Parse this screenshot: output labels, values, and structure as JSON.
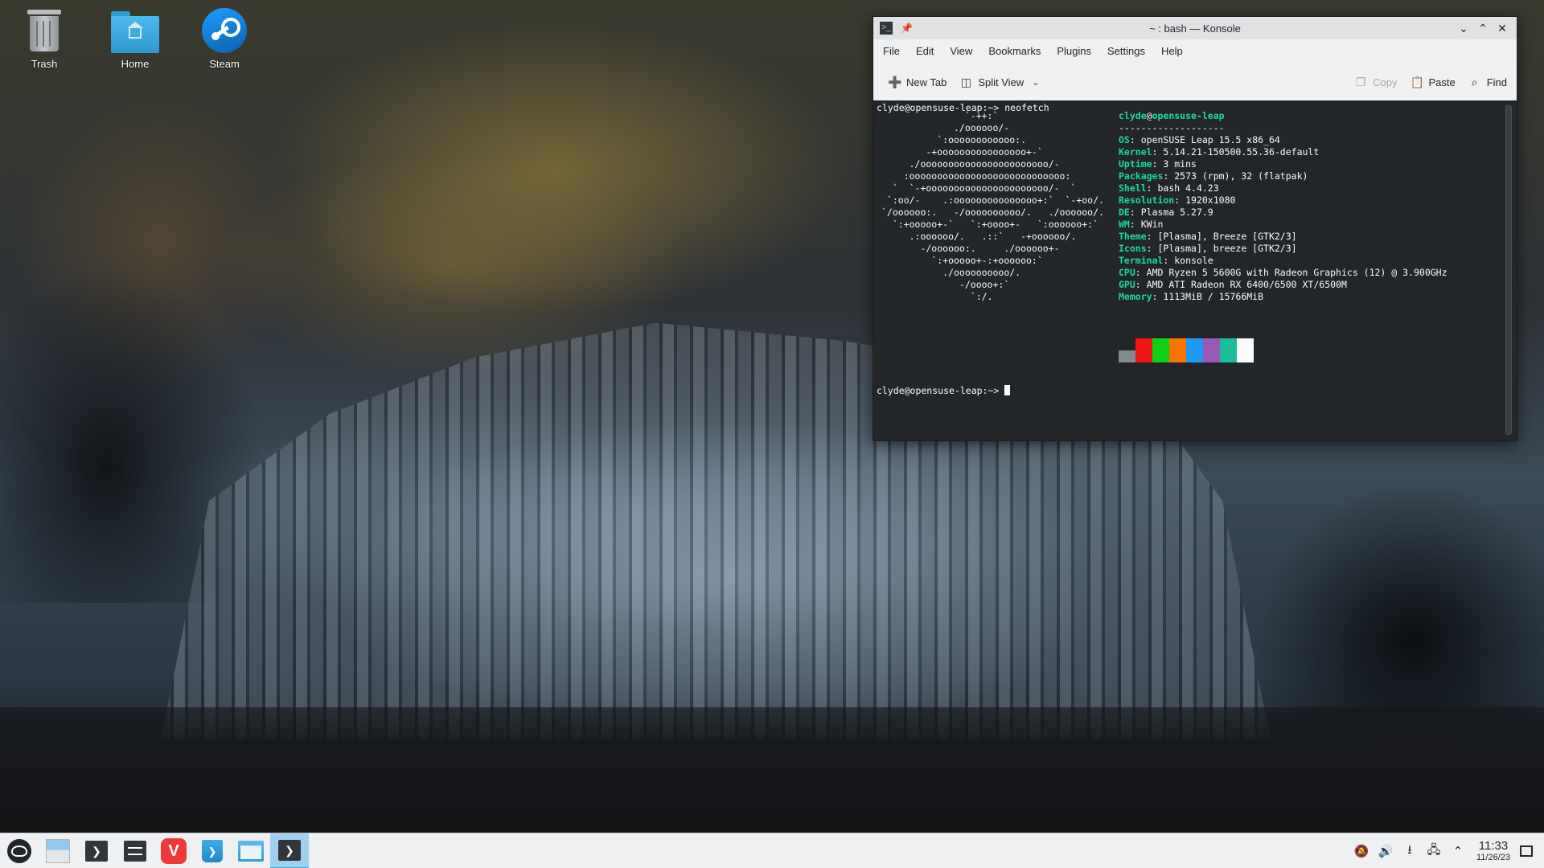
{
  "desktop": {
    "icons": [
      {
        "label": "Trash",
        "icon": "trash-icon"
      },
      {
        "label": "Home",
        "icon": "home-folder-icon"
      },
      {
        "label": "Steam",
        "icon": "steam-icon"
      }
    ]
  },
  "window": {
    "title": "~ : bash — Konsole",
    "app_icon": "konsole-icon",
    "controls": {
      "minimize": "minimize-icon",
      "maximize": "maximize-icon",
      "close": "close-icon"
    },
    "menu": [
      "File",
      "Edit",
      "View",
      "Bookmarks",
      "Plugins",
      "Settings",
      "Help"
    ],
    "toolbar": {
      "new_tab": "New Tab",
      "split_view": "Split View",
      "copy": "Copy",
      "paste": "Paste",
      "find": "Find"
    }
  },
  "terminal": {
    "prompt1": "clyde@opensuse-leap:~> neofetch",
    "logo_lines": [
      "               `-++:`",
      "             ./oooooo/-",
      "          `:oooooooooooo:.",
      "        -+oooooooooooooooo+-`",
      "     ./ooooooooooooooooooooooo/-",
      "    :oooooooooooooooooooooooooooo:",
      "  `  `-+oooooooooooooooooooooo/-  `",
      " `:oo/-    .:ooooooooooooooo+:`  `-+oo/.",
      "`/oooooo:.   -/oooooooooo/.   ./oooooo/.",
      "  `:+ooooo+-`   `:+oooo+-   `:oooooo+:`",
      "     .:oooooo/.   .::`   -+oooooo/.",
      "       -/oooooo:.     ./oooooo+-",
      "         `:+ooooo+-:+oooooo:`",
      "           ./oooooooooo/.",
      "              -/oooo+:`",
      "                `:/."
    ],
    "user": "clyde",
    "host": "opensuse-leap",
    "separator": "-------------------",
    "info": [
      {
        "key": "OS",
        "value": "openSUSE Leap 15.5 x86_64"
      },
      {
        "key": "Kernel",
        "value": "5.14.21-150500.55.36-default"
      },
      {
        "key": "Uptime",
        "value": "3 mins"
      },
      {
        "key": "Packages",
        "value": "2573 (rpm), 32 (flatpak)"
      },
      {
        "key": "Shell",
        "value": "bash 4.4.23"
      },
      {
        "key": "Resolution",
        "value": "1920x1080"
      },
      {
        "key": "DE",
        "value": "Plasma 5.27.9"
      },
      {
        "key": "WM",
        "value": "KWin"
      },
      {
        "key": "Theme",
        "value": "[Plasma], Breeze [GTK2/3]"
      },
      {
        "key": "Icons",
        "value": "[Plasma], breeze [GTK2/3]"
      },
      {
        "key": "Terminal",
        "value": "konsole"
      },
      {
        "key": "CPU",
        "value": "AMD Ryzen 5 5600G with Radeon Graphics (12) @ 3.900GHz"
      },
      {
        "key": "GPU",
        "value": "AMD ATI Radeon RX 6400/6500 XT/6500M"
      },
      {
        "key": "Memory",
        "value": "1113MiB / 15766MiB"
      }
    ],
    "palette": [
      "#7f8c8d",
      "#ed1515",
      "#11d116",
      "#f67400",
      "#1d99f3",
      "#9b59b6",
      "#1abc9c",
      "#fcfcfc"
    ],
    "prompt2": "clyde@opensuse-leap:~> "
  },
  "taskbar": {
    "items": [
      {
        "name": "app-launcher",
        "icon": "opensuse-icon"
      },
      {
        "name": "show-desktop-pager",
        "icon": "desktop-pager-icon"
      },
      {
        "name": "konsole-launcher",
        "icon": "terminal-icon"
      },
      {
        "name": "system-settings",
        "icon": "settings-icon"
      },
      {
        "name": "vivaldi",
        "icon": "vivaldi-icon",
        "glyph": "V"
      },
      {
        "name": "discover",
        "icon": "store-icon"
      },
      {
        "name": "dolphin",
        "icon": "folder-icon"
      },
      {
        "name": "konsole-task",
        "icon": "terminal-icon",
        "active": true
      }
    ],
    "tray": [
      "notifications-muted-icon",
      "volume-icon",
      "usb-icon",
      "network-icon",
      "expand-tray-icon"
    ],
    "clock": {
      "time": "11:33",
      "date": "11/26/23"
    }
  }
}
